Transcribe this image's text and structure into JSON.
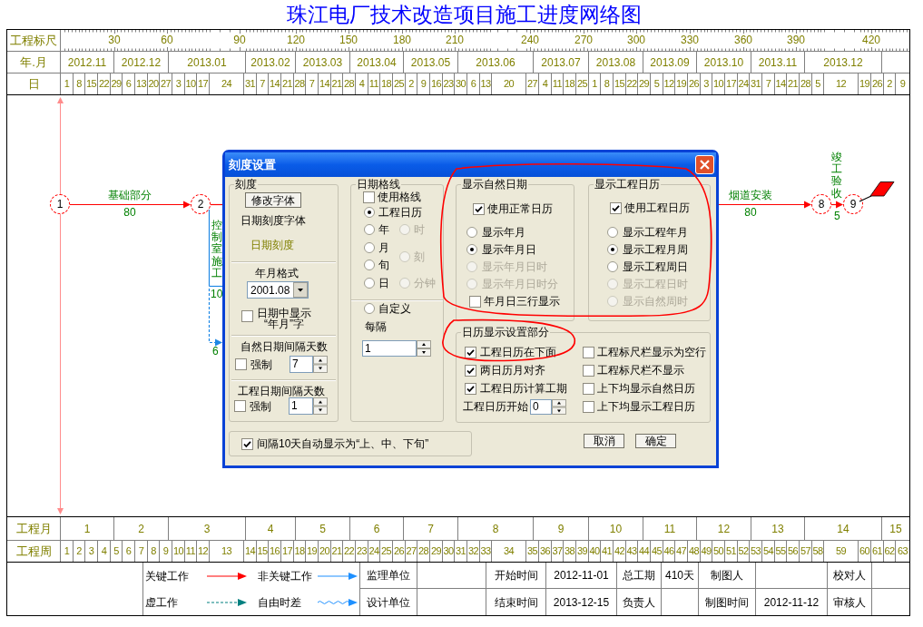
{
  "title": "珠江电厂技术改造项目施工进度网络图",
  "ruler": {
    "label": "工程标尺",
    "ticks": [
      "30",
      "60",
      "90",
      "120",
      "150",
      "180",
      "210",
      "240",
      "270",
      "300",
      "330",
      "360",
      "390",
      "420"
    ]
  },
  "months": {
    "label": "年.月",
    "items": [
      "2012.11",
      "2012.12",
      "2013.01",
      "2013.02",
      "2013.03",
      "2013.04",
      "2013.05",
      "2013.06",
      "2013.07",
      "2013.08",
      "2013.09",
      "2013.10",
      "2013.11",
      "2013.12"
    ]
  },
  "days": {
    "label": "日",
    "items": [
      "1",
      "8",
      "15",
      "22",
      "29",
      "6",
      "13",
      "20",
      "27",
      "3",
      "10",
      "17",
      "24",
      "31",
      "7",
      "14",
      "21",
      "28",
      "7",
      "14",
      "21",
      "28",
      "4",
      "11",
      "18",
      "25",
      "2",
      "9",
      "16",
      "23",
      "30",
      "6",
      "13",
      "20",
      "27",
      "4",
      "11",
      "18",
      "25",
      "1",
      "8",
      "15",
      "22",
      "29",
      "5",
      "12",
      "19",
      "26",
      "3",
      "10",
      "17",
      "24",
      "31",
      "7",
      "14",
      "21",
      "28",
      "5",
      "12",
      "19",
      "26",
      "2",
      "9"
    ]
  },
  "diagram": {
    "nodes": [
      "1",
      "2",
      "8",
      "9"
    ],
    "activities": [
      {
        "kind": "critical",
        "name": "基础部分",
        "duration": "80"
      },
      {
        "kind": "noncritical",
        "name": "控制室施工",
        "duration": "10"
      },
      {
        "kind": "dummy",
        "duration": "6"
      },
      {
        "kind": "critical",
        "name": "烟道安装",
        "duration": "80"
      },
      {
        "kind": "critical",
        "name": "竣工验收",
        "duration": "5"
      }
    ]
  },
  "dialog": {
    "title": "刻度设置",
    "scale": {
      "title": "刻度",
      "font_button": "修改字体",
      "font_label": "日期刻度字体",
      "font_sample": "日期刻度",
      "format_label": "年月格式",
      "format_value": "2001.08",
      "show_ym": {
        "lines": [
          "日期中显示",
          "“年月”字"
        ],
        "checked": false
      },
      "natural_interval": {
        "label": "自然日期间隔天数",
        "force": {
          "label": "强制",
          "checked": false
        },
        "value": "7"
      },
      "project_interval": {
        "label": "工程日期间隔天数",
        "force": {
          "label": "强制",
          "checked": false
        },
        "value": "1"
      }
    },
    "gridlines": {
      "title": "日期格线",
      "use_grid": {
        "label": "使用格线",
        "checked": false
      },
      "calendar_option": {
        "label": "工程日历",
        "selected": true,
        "disabled": false
      },
      "left_options": [
        {
          "label": "年",
          "selected": false,
          "disabled": false
        },
        {
          "label": "月",
          "selected": false,
          "disabled": false
        },
        {
          "label": "旬",
          "selected": false,
          "disabled": false
        },
        {
          "label": "日",
          "selected": false,
          "disabled": false
        }
      ],
      "right_options": [
        {
          "label": "时",
          "selected": false,
          "disabled": true
        },
        {
          "label": "刻",
          "selected": false,
          "disabled": true
        },
        {
          "label": "分钟",
          "selected": false,
          "disabled": true
        }
      ],
      "custom_option": {
        "label": "自定义",
        "selected": false,
        "disabled": false
      },
      "interval_label": "每隔",
      "interval_value": "1"
    },
    "natural_calendar": {
      "title": "显示自然日期",
      "use": {
        "label": "使用正常日历",
        "checked": true
      },
      "options": [
        {
          "label": "显示年月",
          "selected": false,
          "disabled": false
        },
        {
          "label": "显示年月日",
          "selected": true,
          "disabled": false
        },
        {
          "label": "显示年月日时",
          "selected": false,
          "disabled": true
        },
        {
          "label": "显示年月日时分",
          "selected": false,
          "disabled": true
        }
      ],
      "three_rows": {
        "label": "年月日三行显示",
        "checked": false
      }
    },
    "project_calendar": {
      "title": "显示工程日历",
      "use": {
        "label": "使用工程日历",
        "checked": true
      },
      "options": [
        {
          "label": "显示工程年月",
          "selected": false,
          "disabled": false
        },
        {
          "label": "显示工程月周",
          "selected": true,
          "disabled": false
        },
        {
          "label": "显示工程周日",
          "selected": false,
          "disabled": false
        },
        {
          "label": "显示工程日时",
          "selected": false,
          "disabled": true
        },
        {
          "label": "显示自然周时",
          "selected": false,
          "disabled": true
        }
      ]
    },
    "display": {
      "title": "日历显示设置部分",
      "left_checks": [
        {
          "label": "工程日历在下面",
          "checked": true
        },
        {
          "label": "两日历月对齐",
          "checked": true
        },
        {
          "label": "工程日历计算工期",
          "checked": true
        }
      ],
      "start_label": "工程日历开始",
      "start_value": "0",
      "right_checks": [
        {
          "label": "工程标尺栏显示为空行",
          "checked": false
        },
        {
          "label": "工程标尺栏不显示",
          "checked": false
        },
        {
          "label": "上下均显示自然日历",
          "checked": false
        },
        {
          "label": "上下均显示工程日历",
          "checked": false
        }
      ]
    },
    "auto_xun": {
      "label": "间隔10天自动显示为“上、中、下旬”",
      "checked": true
    },
    "buttons": [
      "取消",
      "确定"
    ]
  },
  "project_months": {
    "label": "工程月",
    "items": [
      "1",
      "2",
      "3",
      "4",
      "5",
      "6",
      "7",
      "8",
      "9",
      "10",
      "11",
      "12",
      "13",
      "14",
      "15"
    ]
  },
  "project_weeks": {
    "label": "工程周",
    "items": [
      "1",
      "2",
      "3",
      "4",
      "5",
      "6",
      "7",
      "8",
      "9",
      "10",
      "11",
      "12",
      "13",
      "14",
      "15",
      "16",
      "17",
      "18",
      "19",
      "20",
      "21",
      "22",
      "23",
      "24",
      "25",
      "26",
      "27",
      "28",
      "29",
      "30",
      "31",
      "32",
      "33",
      "34",
      "35",
      "36",
      "37",
      "38",
      "39",
      "40",
      "41",
      "42",
      "43",
      "44",
      "45",
      "46",
      "47",
      "48",
      "49",
      "50",
      "51",
      "52",
      "53",
      "54",
      "55",
      "56",
      "57",
      "58",
      "59",
      "60",
      "61",
      "62",
      "63"
    ]
  },
  "legend": [
    {
      "kind": "critical",
      "label": "关键工作"
    },
    {
      "kind": "noncritical",
      "label": "非关键工作"
    },
    {
      "kind": "dummy",
      "label": "虚工作"
    },
    {
      "kind": "float",
      "label": "自由时差"
    }
  ],
  "info_rows": [
    [
      "监理单位",
      null,
      "开始时间",
      "2012-11-01",
      "总工期",
      "410天",
      "制图人",
      null,
      "校对人",
      null
    ],
    [
      "设计单位",
      null,
      "结束时间",
      "2013-12-15",
      "负责人",
      null,
      "制图时间",
      "2012-11-12",
      "审核人",
      null
    ]
  ]
}
